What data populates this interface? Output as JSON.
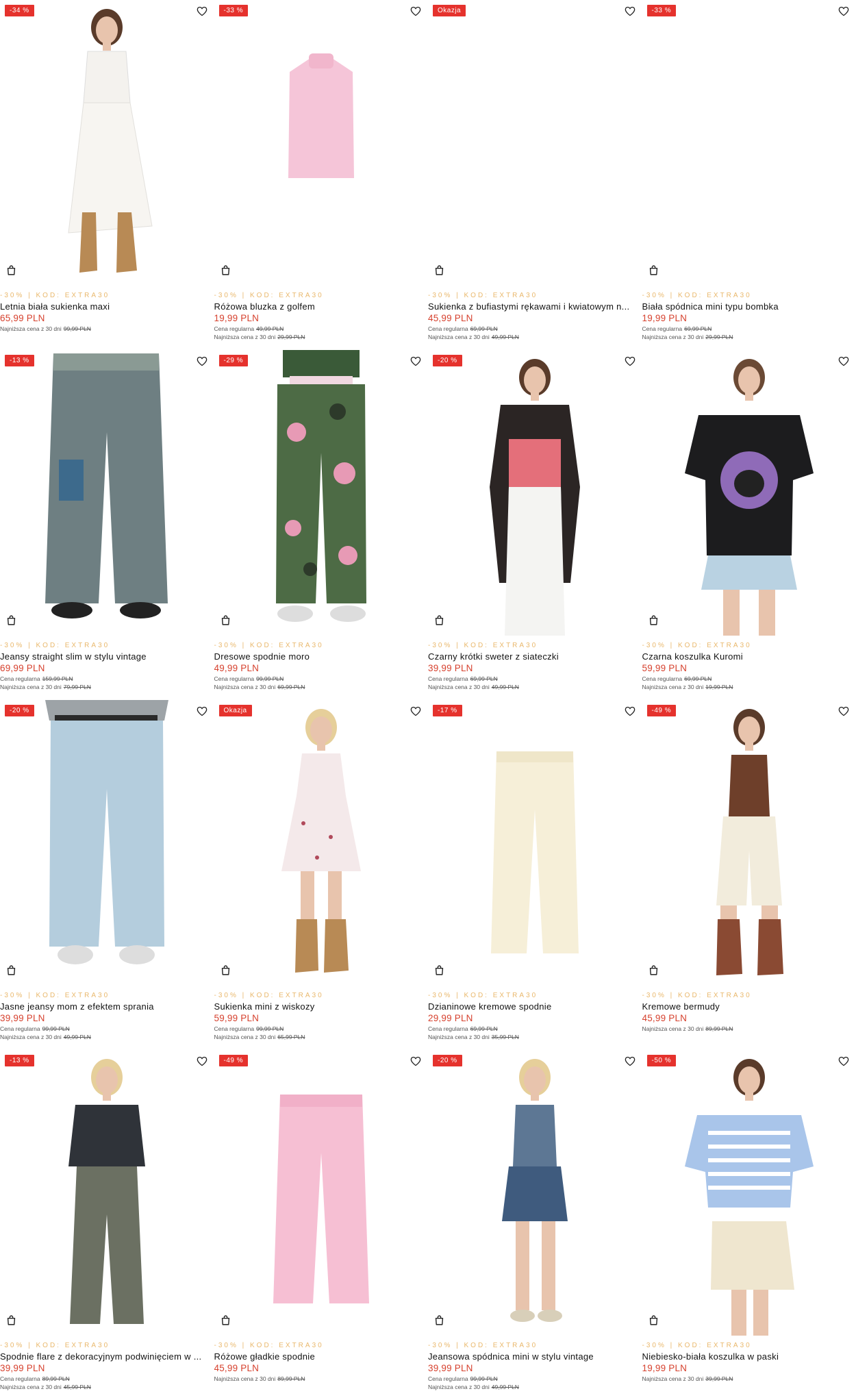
{
  "icons": {
    "favorite": "heart-outline-icon",
    "add_to_cart": "shopping-bag-icon"
  },
  "colors": {
    "badge": "#e5322d",
    "price": "#d6402d",
    "promo": "#e9b86c"
  },
  "products": [
    {
      "badge": "-34 %",
      "promo": "-30% | KOD: EXTRA30",
      "name": "Letnia biała sukienka maxi",
      "price": "65,99 PLN",
      "regular_label": "",
      "regular_price": "",
      "lowest_label": "Najniższa cena z 30 dni",
      "lowest_price": "99,99 PLN"
    },
    {
      "badge": "-33 %",
      "promo": "-30% | KOD: EXTRA30",
      "name": "Różowa bluzka z golfem",
      "price": "19,99 PLN",
      "regular_label": "Cena regularna",
      "regular_price": "49,99 PLN",
      "lowest_label": "Najniższa cena z 30 dni",
      "lowest_price": "29,99 PLN"
    },
    {
      "badge": "Okazja",
      "promo": "-30% | KOD: EXTRA30",
      "name": "Sukienka z bufiastymi rękawami i kwiatowym n...",
      "price": "45,99 PLN",
      "regular_label": "Cena regularna",
      "regular_price": "69,99 PLN",
      "lowest_label": "Najniższa cena z 30 dni",
      "lowest_price": "49,99 PLN"
    },
    {
      "badge": "-33 %",
      "promo": "-30% | KOD: EXTRA30",
      "name": "Biała spódnica mini typu bombka",
      "price": "19,99 PLN",
      "regular_label": "Cena regularna",
      "regular_price": "69,99 PLN",
      "lowest_label": "Najniższa cena z 30 dni",
      "lowest_price": "29,99 PLN"
    },
    {
      "badge": "-13 %",
      "promo": "-30% | KOD: EXTRA30",
      "name": "Jeansy straight slim w stylu vintage",
      "price": "69,99 PLN",
      "regular_label": "Cena regularna",
      "regular_price": "159,99 PLN",
      "lowest_label": "Najniższa cena z 30 dni",
      "lowest_price": "79,99 PLN"
    },
    {
      "badge": "-29 %",
      "promo": "-30% | KOD: EXTRA30",
      "name": "Dresowe spodnie moro",
      "price": "49,99 PLN",
      "regular_label": "Cena regularna",
      "regular_price": "99,99 PLN",
      "lowest_label": "Najniższa cena z 30 dni",
      "lowest_price": "69,99 PLN"
    },
    {
      "badge": "-20 %",
      "promo": "-30% | KOD: EXTRA30",
      "name": "Czarny krótki sweter z siateczki",
      "price": "39,99 PLN",
      "regular_label": "Cena regularna",
      "regular_price": "69,99 PLN",
      "lowest_label": "Najniższa cena z 30 dni",
      "lowest_price": "49,99 PLN"
    },
    {
      "badge": "",
      "promo": "-30% | KOD: EXTRA30",
      "name": "Czarna koszulka Kuromi",
      "price": "59,99 PLN",
      "regular_label": "Cena regularna",
      "regular_price": "69,99 PLN",
      "lowest_label": "Najniższa cena z 30 dni",
      "lowest_price": "19,99 PLN"
    },
    {
      "badge": "-20 %",
      "promo": "-30% | KOD: EXTRA30",
      "name": "Jasne jeansy mom z efektem sprania",
      "price": "39,99 PLN",
      "regular_label": "Cena regularna",
      "regular_price": "99,99 PLN",
      "lowest_label": "Najniższa cena z 30 dni",
      "lowest_price": "49,99 PLN"
    },
    {
      "badge": "Okazja",
      "promo": "-30% | KOD: EXTRA30",
      "name": "Sukienka mini z wiskozy",
      "price": "59,99 PLN",
      "regular_label": "Cena regularna",
      "regular_price": "99,99 PLN",
      "lowest_label": "Najniższa cena z 30 dni",
      "lowest_price": "65,99 PLN"
    },
    {
      "badge": "-17 %",
      "promo": "-30% | KOD: EXTRA30",
      "name": "Dzianinowe kremowe spodnie",
      "price": "29,99 PLN",
      "regular_label": "Cena regularna",
      "regular_price": "69,99 PLN",
      "lowest_label": "Najniższa cena z 30 dni",
      "lowest_price": "35,99 PLN"
    },
    {
      "badge": "-49 %",
      "promo": "-30% | KOD: EXTRA30",
      "name": "Kremowe bermudy",
      "price": "45,99 PLN",
      "regular_label": "",
      "regular_price": "",
      "lowest_label": "Najniższa cena z 30 dni",
      "lowest_price": "89,99 PLN"
    },
    {
      "badge": "-13 %",
      "promo": "-30% | KOD: EXTRA30",
      "name": "Spodnie flare z dekoracyjnym podwinięciem w ...",
      "price": "39,99 PLN",
      "regular_label": "Cena regularna",
      "regular_price": "89,99 PLN",
      "lowest_label": "Najniższa cena z 30 dni",
      "lowest_price": "45,99 PLN"
    },
    {
      "badge": "-49 %",
      "promo": "-30% | KOD: EXTRA30",
      "name": "Różowe gładkie spodnie",
      "price": "45,99 PLN",
      "regular_label": "",
      "regular_price": "",
      "lowest_label": "Najniższa cena z 30 dni",
      "lowest_price": "89,99 PLN"
    },
    {
      "badge": "-20 %",
      "promo": "-30% | KOD: EXTRA30",
      "name": "Jeansowa spódnica mini w stylu vintage",
      "price": "39,99 PLN",
      "regular_label": "Cena regularna",
      "regular_price": "99,99 PLN",
      "lowest_label": "Najniższa cena z 30 dni",
      "lowest_price": "49,99 PLN"
    },
    {
      "badge": "-50 %",
      "promo": "-30% | KOD: EXTRA30",
      "name": "Niebiesko-biała koszulka w paski",
      "price": "19,99 PLN",
      "regular_label": "",
      "regular_price": "",
      "lowest_label": "Najniższa cena z 30 dni",
      "lowest_price": "39,99 PLN"
    }
  ]
}
